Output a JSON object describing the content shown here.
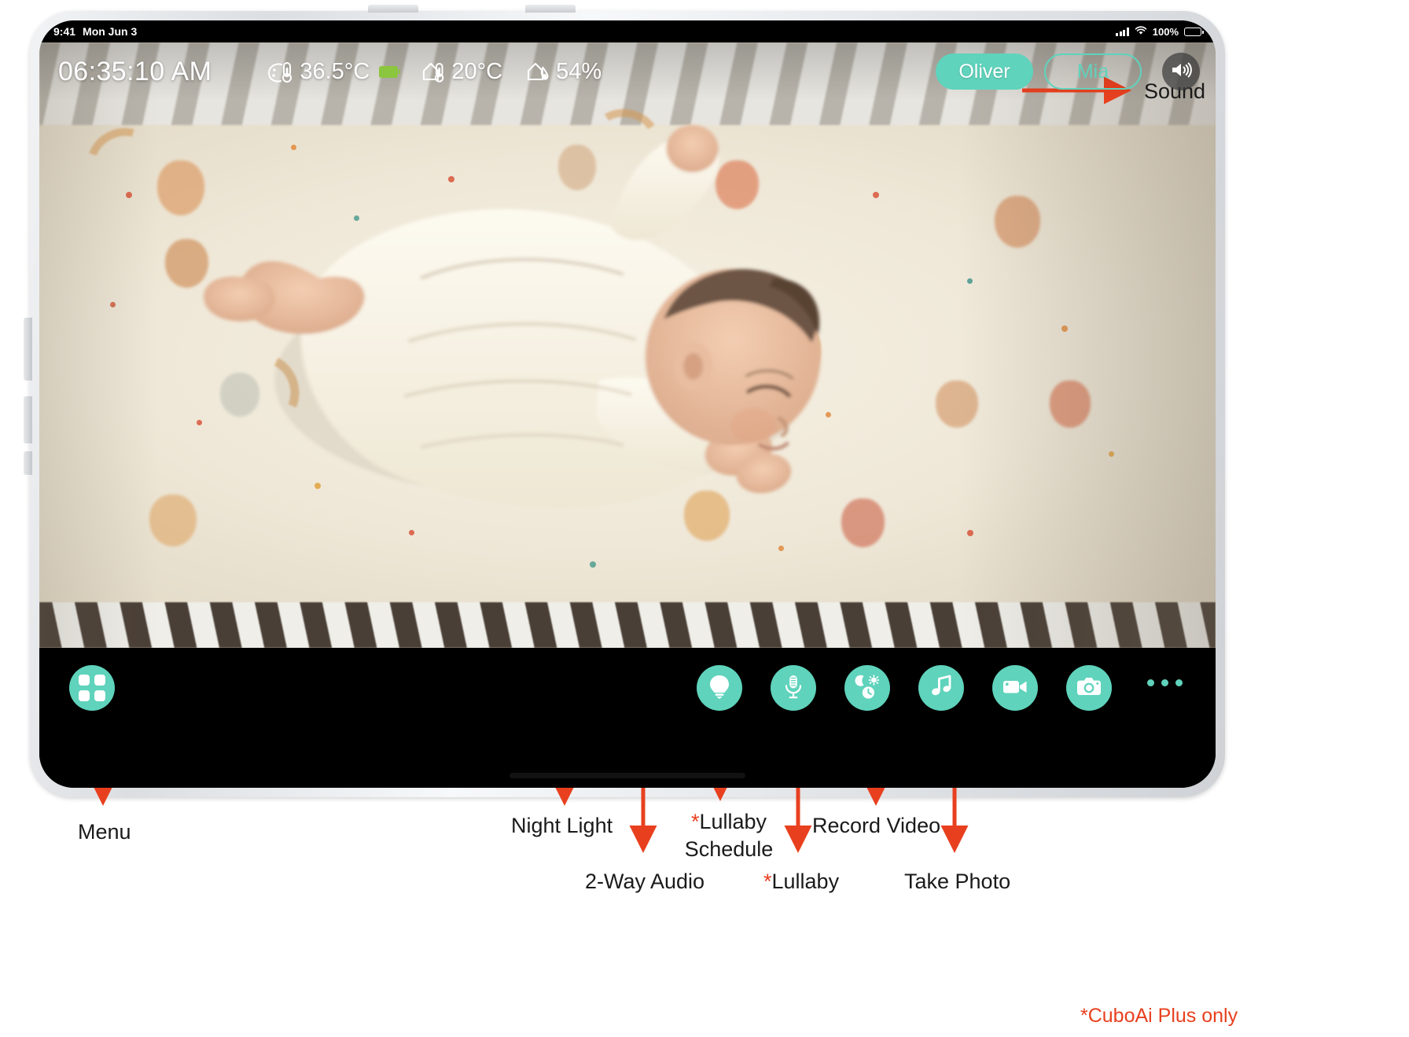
{
  "colors": {
    "accent_teal": "#5FD3BC",
    "annotation_red": "#E8401F",
    "battery_green": "#8CC63F",
    "bar_black": "#000000"
  },
  "ios_status_bar": {
    "time": "9:41",
    "date": "Mon Jun 3",
    "battery_percent": "100%",
    "signal_icon": "cellular-signal-icon",
    "wifi_icon": "wifi-icon",
    "battery_icon": "battery-full-icon"
  },
  "app": {
    "clock": "06:35:10 AM",
    "metrics": [
      {
        "id": "body-temperature",
        "icon": "body-temperature-icon",
        "value": "36.5°C",
        "has_battery_chip": true
      },
      {
        "id": "room-temperature",
        "icon": "room-temperature-icon",
        "value": "20°C",
        "has_battery_chip": false
      },
      {
        "id": "room-humidity",
        "icon": "room-humidity-icon",
        "value": "54%",
        "has_battery_chip": false
      }
    ],
    "profiles": [
      {
        "name": "Oliver",
        "active": true
      },
      {
        "name": "Mia",
        "active": false
      }
    ],
    "sound_button": {
      "icon": "sound-speaker-icon"
    },
    "menu_button": {
      "icon": "grid-menu-icon"
    },
    "tools": [
      {
        "id": "night-light",
        "icon": "light-bulb-icon"
      },
      {
        "id": "two-way-audio",
        "icon": "microphone-icon"
      },
      {
        "id": "lullaby-schedule",
        "icon": "moon-sun-clock-icon"
      },
      {
        "id": "lullaby",
        "icon": "music-note-icon"
      },
      {
        "id": "record-video",
        "icon": "video-camera-icon"
      },
      {
        "id": "take-photo",
        "icon": "photo-camera-icon"
      }
    ],
    "more_button": {
      "icon": "more-dots-icon"
    }
  },
  "annotations": {
    "sound": "Sound",
    "menu": "Menu",
    "night_light": "Night Light",
    "two_way_audio": "2-Way Audio",
    "lullaby_schedule_star": "*",
    "lullaby_schedule": "Lullaby Schedule",
    "lullaby_schedule_line1": "Lullaby",
    "lullaby_schedule_line2": "Schedule",
    "lullaby_star": "*",
    "lullaby": "Lullaby",
    "record_video": "Record Video",
    "take_photo": "Take Photo",
    "footnote": "*CuboAi Plus only"
  }
}
